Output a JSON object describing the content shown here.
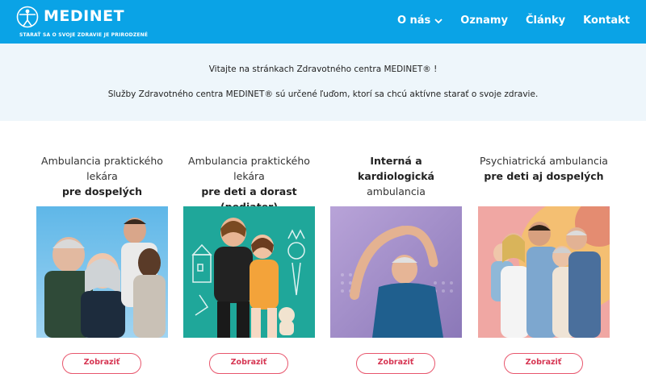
{
  "header": {
    "logo_text": "MEDINET",
    "tagline": "STARAŤ SA O SVOJE ZDRAVIE JE PRIRODZENÉ",
    "nav": [
      {
        "label": "O nás",
        "has_dropdown": true
      },
      {
        "label": "Oznamy"
      },
      {
        "label": "Články"
      },
      {
        "label": "Kontakt"
      }
    ],
    "color": "#0aa3e6"
  },
  "welcome": {
    "line1": "Vitajte na stránkach Zdravotného centra MEDINET® !",
    "line2": "Služby Zdravotného centra MEDINET® sú určené ľuďom, ktorí sa chcú aktívne starať o svoje zdravie."
  },
  "cards": [
    {
      "title_normal": "Ambulancia praktického lekára",
      "title_bold": "pre dospelých",
      "button": "Zobraziť"
    },
    {
      "title_normal": "Ambulancia praktického lekára",
      "title_bold": "pre deti a dorast (pediater)",
      "button": "Zobraziť"
    },
    {
      "title_bold": "Interná a kardiologická",
      "title_normal": "ambulancia",
      "button": "Zobraziť"
    },
    {
      "title_normal": "Psychiatrická ambulancia",
      "title_bold": "pre deti aj dospelých",
      "button": "Zobraziť"
    }
  ],
  "accent_color": "#e8566d"
}
